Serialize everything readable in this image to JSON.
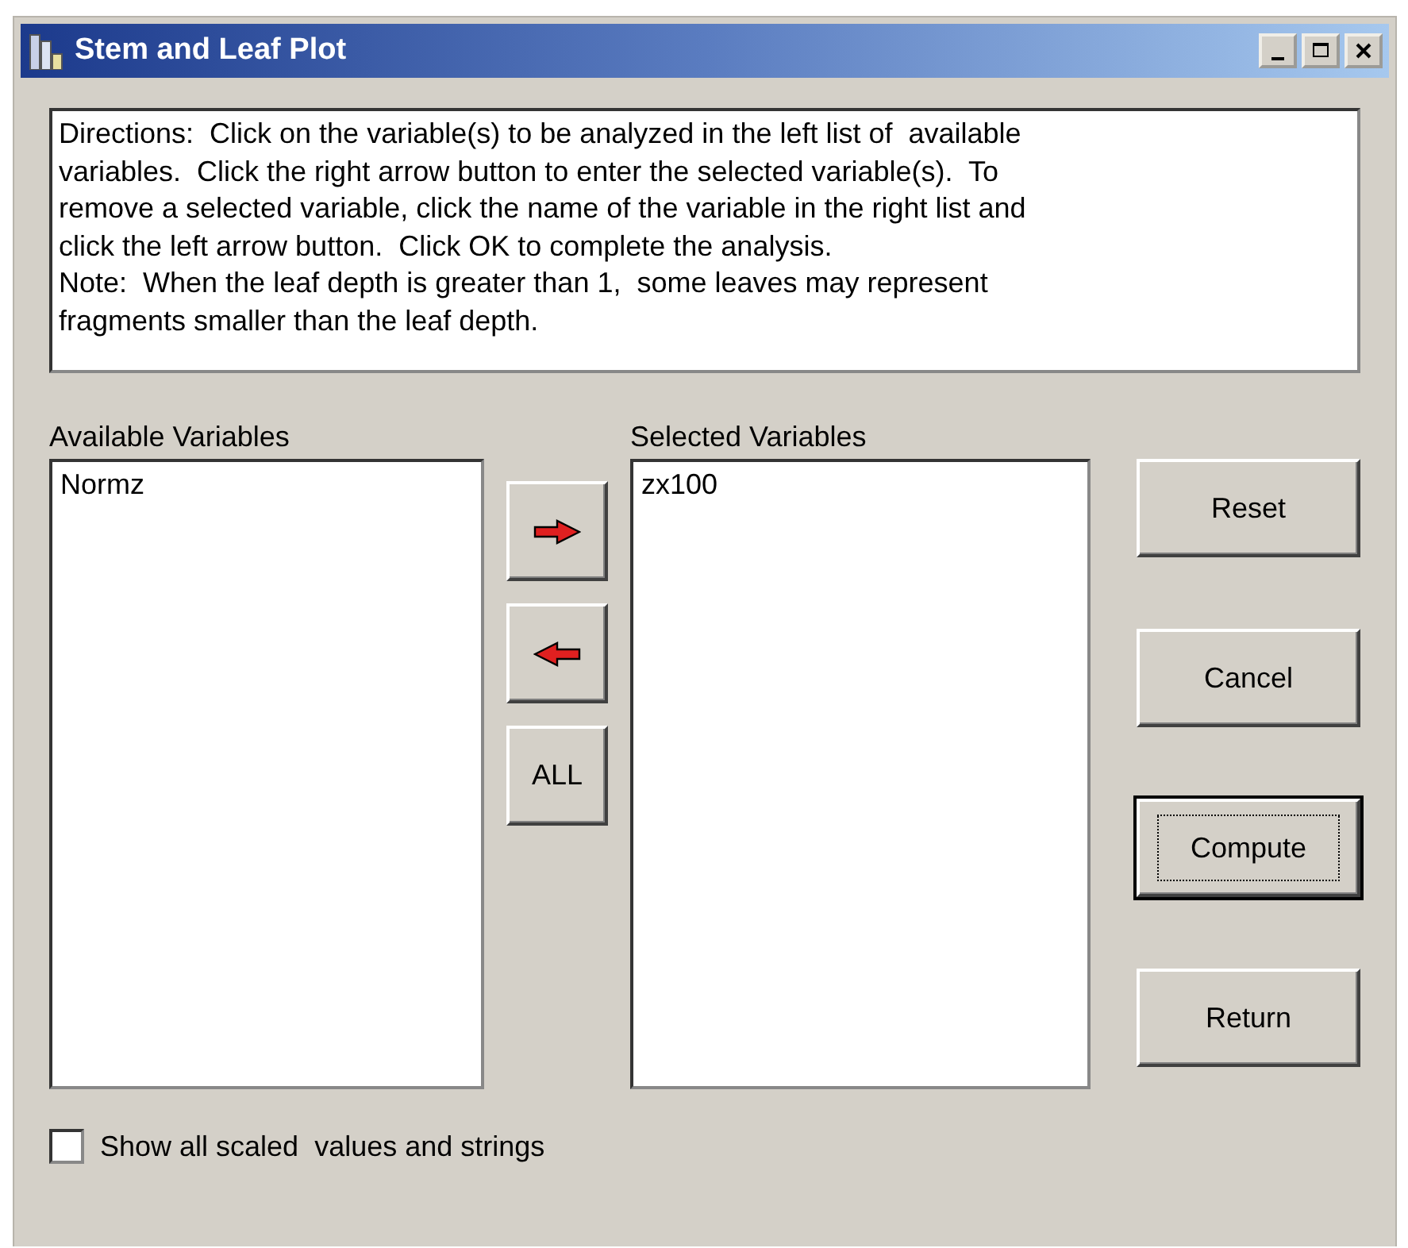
{
  "window": {
    "title": "Stem and Leaf Plot",
    "controls": [
      {
        "kind": "minimize"
      },
      {
        "kind": "maximize"
      },
      {
        "kind": "close"
      }
    ]
  },
  "directions": "Directions:  Click on the variable(s) to be analyzed in the left list of  available\nvariables.  Click the right arrow button to enter the selected variable(s).  To\nremove a selected variable, click the name of the variable in the right list and\nclick the left arrow button.  Click OK to complete the analysis.\nNote:  When the leaf depth is greater than 1,  some leaves may represent\nfragments smaller than the leaf depth.",
  "available": {
    "label": "Available Variables",
    "items": [
      {
        "label": "Normz",
        "selected": false
      }
    ]
  },
  "transfer_buttons": [
    {
      "kind": "arrow_right"
    },
    {
      "kind": "arrow_left"
    },
    {
      "kind": "text",
      "label": "ALL"
    }
  ],
  "selected": {
    "label": "Selected Variables",
    "items": [
      {
        "label": "zx100",
        "selected": false
      }
    ]
  },
  "action_buttons": [
    {
      "label": "Reset",
      "default": false
    },
    {
      "label": "Cancel",
      "default": false
    },
    {
      "label": "Compute",
      "default": true
    },
    {
      "label": "Return",
      "default": false
    }
  ],
  "show_all": {
    "label": "Show all scaled  values and strings",
    "checked": false
  }
}
